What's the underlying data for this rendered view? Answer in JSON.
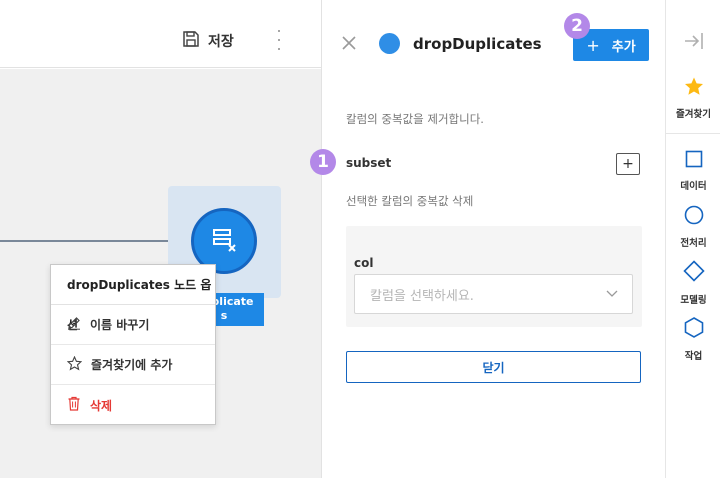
{
  "toolbar": {
    "save_label": "저장"
  },
  "canvas": {
    "node_label_line1": "Duplicate",
    "node_label_line2": "s"
  },
  "context_menu": {
    "title": "dropDuplicates 노드 옵션",
    "items": [
      {
        "label": "이름 바꾸기",
        "icon": "pencil-icon"
      },
      {
        "label": "즐겨찾기에 추가",
        "icon": "star-outline-icon"
      },
      {
        "label": "삭제",
        "icon": "trash-icon",
        "color": "#e53935"
      }
    ]
  },
  "panel": {
    "title": "dropDuplicates",
    "add_button_label": "추가",
    "description": "칼럼의 중복값을 제거합니다.",
    "subset_label": "subset",
    "subset_description": "선택한 칼럼의 중복값 삭제",
    "col_label": "col",
    "col_placeholder": "칼럼을 선택하세요.",
    "close_button_label": "닫기",
    "badge_1": "1",
    "badge_2": "2",
    "accent_color": "#1e88e5",
    "badge_color": "#b388e8"
  },
  "sidebar": {
    "items": [
      {
        "label": "즐겨찾기",
        "icon": "star-icon"
      },
      {
        "label": "데이터",
        "icon": "square-icon"
      },
      {
        "label": "전처리",
        "icon": "circle-icon"
      },
      {
        "label": "모델링",
        "icon": "diamond-icon"
      },
      {
        "label": "작업",
        "icon": "hexagon-icon"
      }
    ]
  }
}
